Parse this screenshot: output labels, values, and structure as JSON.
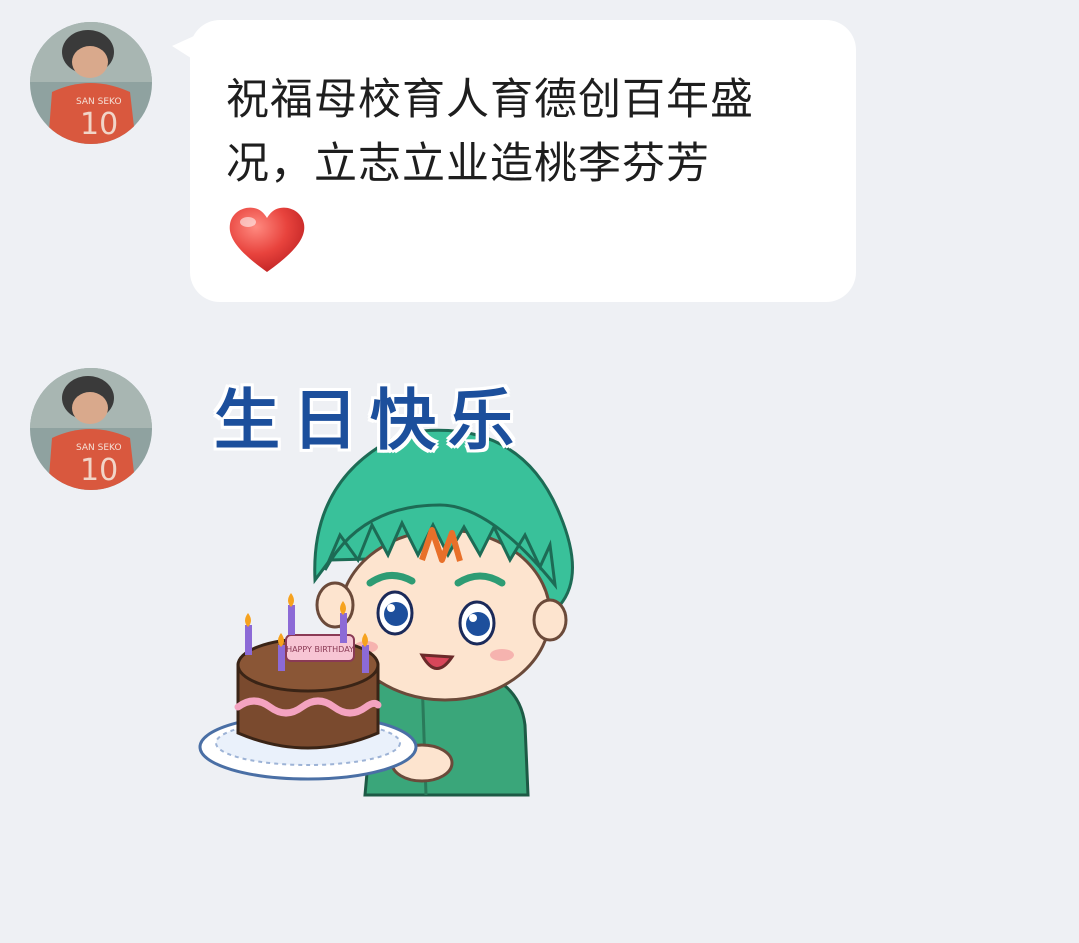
{
  "conversation": {
    "messages": [
      {
        "type": "text",
        "text": "祝福母校育人育德创百年盛况，立志立业造桃李芬芳",
        "emoji": "red-heart"
      },
      {
        "type": "sticker",
        "caption": "生日快乐",
        "cake_plaque": "HAPPY BIRTHDAY",
        "jersey_number": "10"
      }
    ],
    "avatar": {
      "jersey_number": "10",
      "jersey_name": "SAN SEKO"
    }
  },
  "colors": {
    "background": "#eef0f4",
    "bubble": "#ffffff",
    "text": "#1e1e1e",
    "sticker_title": "#1c4f9c",
    "heart": "#e8433d"
  }
}
